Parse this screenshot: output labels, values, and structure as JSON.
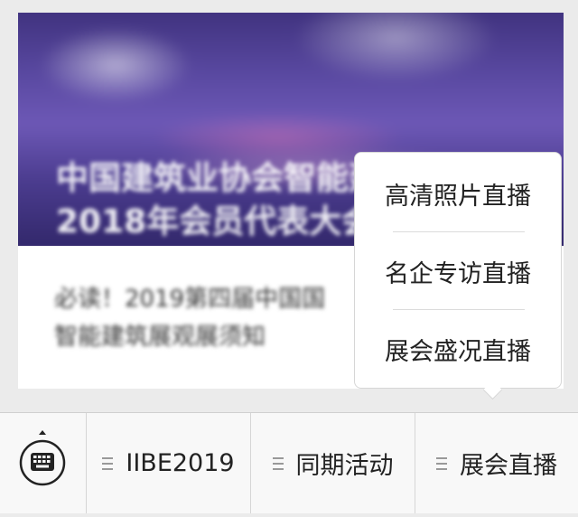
{
  "card": {
    "banner_line1": "中国建筑业协会智能建",
    "banner_line2": "2018年会员代表大会",
    "title_line1": "必读！2019第四届中国国",
    "title_line2": "智能建筑展观展须知"
  },
  "popup": {
    "items": [
      {
        "label": "高清照片直播"
      },
      {
        "label": "名企专访直播"
      },
      {
        "label": "展会盛况直播"
      }
    ]
  },
  "menubar": {
    "keyboard_icon": "keyboard-icon",
    "menus": [
      {
        "label": "IIBE2019",
        "icon": "menu-lines-icon"
      },
      {
        "label": "同期活动",
        "icon": "menu-lines-icon"
      },
      {
        "label": "展会直播",
        "icon": "menu-lines-icon"
      }
    ]
  },
  "colors": {
    "background": "#ebebeb",
    "menubar_bg": "#f8f8f8",
    "text": "#222222",
    "banner_purple": "#5b4aa3"
  }
}
